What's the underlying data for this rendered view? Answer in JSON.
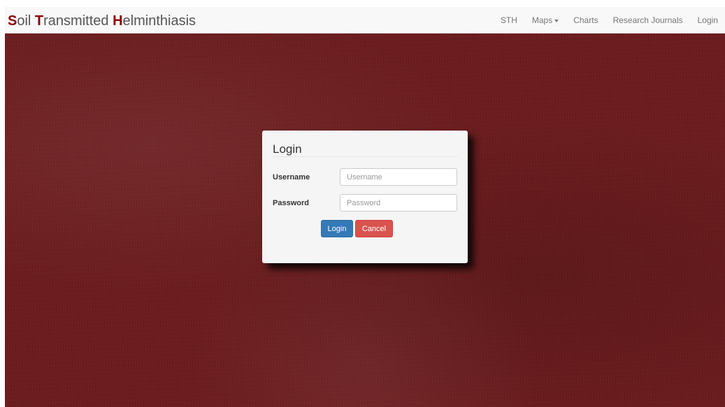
{
  "brand": {
    "parts": [
      {
        "cap": "S",
        "rest": "oil "
      },
      {
        "cap": "T",
        "rest": "ransmitted "
      },
      {
        "cap": "H",
        "rest": "elminthiasis"
      }
    ],
    "accent_color": "#8b0000"
  },
  "nav": {
    "items": [
      {
        "label": "STH"
      },
      {
        "label": "Maps",
        "has_dropdown": true
      },
      {
        "label": "Charts"
      },
      {
        "label": "Research Journals"
      },
      {
        "label": "Login"
      }
    ]
  },
  "login_modal": {
    "title": "Login",
    "username": {
      "label": "Username",
      "placeholder": "Username",
      "value": ""
    },
    "password": {
      "label": "Password",
      "placeholder": "Password",
      "value": ""
    },
    "login_button": "Login",
    "cancel_button": "Cancel"
  },
  "colors": {
    "background": "#6b1c1e",
    "primary": "#337ab7",
    "danger": "#d9534f"
  }
}
